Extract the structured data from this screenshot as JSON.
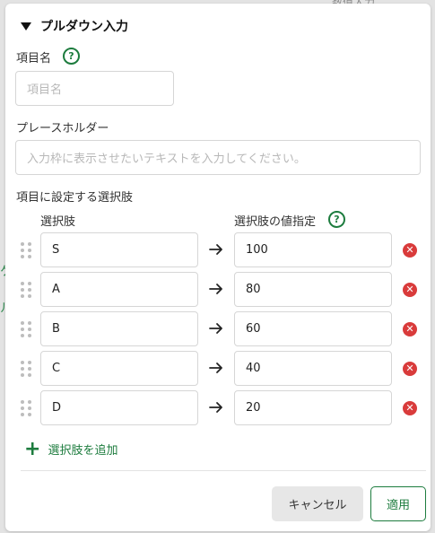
{
  "background": {
    "top_text": "数值入力",
    "left_mark_1": "ケ",
    "left_mark_2": "ル"
  },
  "header": {
    "title": "プルダウン入力"
  },
  "fields": {
    "item_name": {
      "label": "項目名",
      "placeholder": "項目名"
    },
    "placeholder_field": {
      "label": "プレースホルダー",
      "placeholder": "入力枠に表示させたいテキストを入力してください。"
    }
  },
  "options": {
    "section_label": "項目に設定する選択肢",
    "col_choice": "選択肢",
    "col_value": "選択肢の値指定",
    "rows": [
      {
        "choice": "S",
        "value": "100"
      },
      {
        "choice": "A",
        "value": "80"
      },
      {
        "choice": "B",
        "value": "60"
      },
      {
        "choice": "C",
        "value": "40"
      },
      {
        "choice": "D",
        "value": "20"
      }
    ],
    "add_label": "選択肢を追加"
  },
  "buttons": {
    "cancel": "キャンセル",
    "apply": "適用"
  },
  "colors": {
    "accent": "#1d7c3e",
    "danger": "#d93b3b"
  },
  "icons": {
    "help": "question-circle-icon",
    "drag": "drag-handle-icon",
    "arrow": "arrow-right-icon",
    "remove": "remove-circle-icon",
    "add": "plus-icon"
  }
}
